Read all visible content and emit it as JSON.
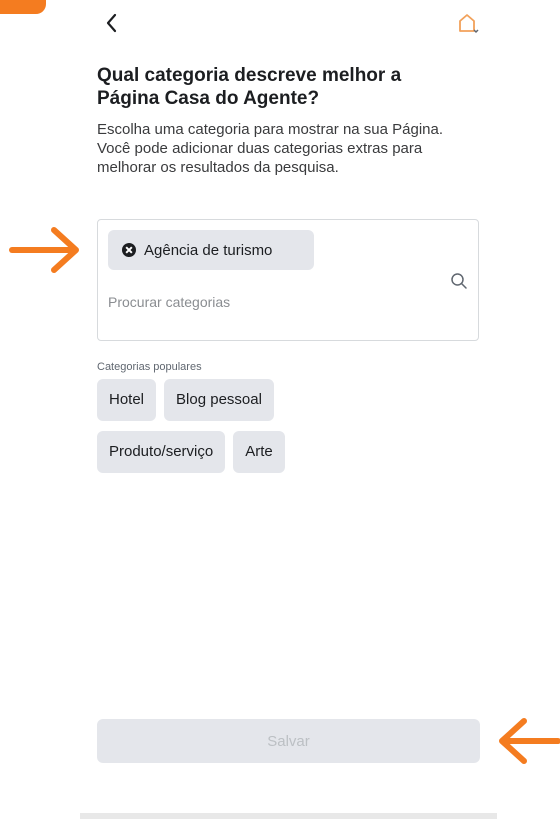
{
  "header": {
    "back_icon": "chevron-left-icon",
    "page_icon": "page-switch-icon"
  },
  "title": "Qual categoria descreve melhor a Página Casa do Agente?",
  "description": "Escolha uma categoria para mostrar na sua Página. Você pode adicionar duas categorias extras para melhorar os resultados da pesquisa.",
  "selected_category": "Agência de turismo",
  "search": {
    "placeholder": "Procurar categorias",
    "value": ""
  },
  "popular": {
    "label": "Categorias populares",
    "items": [
      "Hotel",
      "Blog pessoal",
      "Produto/serviço",
      "Arte"
    ]
  },
  "save_label": "Salvar",
  "colors": {
    "accent": "#f47c20",
    "chip": "#e4e6eb",
    "disabled_text": "#bcc0c4"
  }
}
